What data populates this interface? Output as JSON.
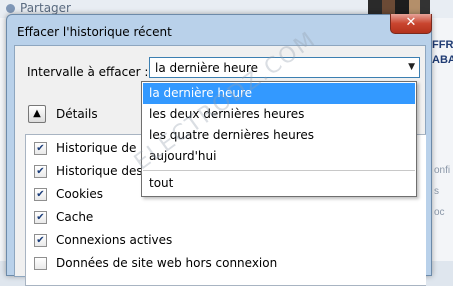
{
  "background": {
    "share_label": "Partager",
    "right_text_lines": [
      "FFRE",
      "ABA"
    ],
    "right_small_lines": [
      "onfi",
      "s",
      "oc"
    ]
  },
  "dialog": {
    "title": "Effacer l'historique récent",
    "close_symbol": "✕",
    "interval_label": "Intervalle à effacer :",
    "selected_interval": "la dernière heure",
    "details_label": "Détails",
    "details_toggle_symbol": "▲",
    "items": [
      {
        "label": "Historique de nav",
        "checked": true
      },
      {
        "label": "Historique des for",
        "checked": true
      },
      {
        "label": "Cookies",
        "checked": true
      },
      {
        "label": "Cache",
        "checked": true
      },
      {
        "label": "Connexions actives",
        "checked": true
      },
      {
        "label": "Données de site web hors connexion",
        "checked": false
      }
    ]
  },
  "dropdown": {
    "options": [
      {
        "label": "la dernière heure",
        "selected": true
      },
      {
        "label": "les deux dernières heures",
        "selected": false
      },
      {
        "label": "les quatre dernières heures",
        "selected": false
      },
      {
        "label": "aujourd'hui",
        "selected": false
      },
      {
        "label": "tout",
        "selected": false
      }
    ]
  },
  "watermark": "ELECTRODZ.COM",
  "colors": {
    "selection": "#3399ff",
    "window_frame": "#b9d1ea",
    "close_button": "#c9452f"
  }
}
